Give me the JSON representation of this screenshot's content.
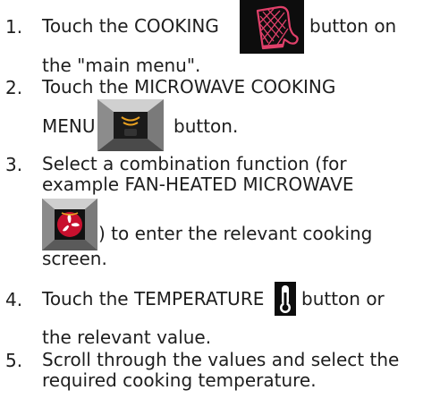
{
  "steps": [
    {
      "num": "1.",
      "line1_before": "Touch the COOKING",
      "line1_after": "button on",
      "line2": "the \"main menu\".",
      "icon": "oven-mitt-icon"
    },
    {
      "num": "2.",
      "line1": "Touch the MICROWAVE COOKING",
      "line2_before": "MENU",
      "line2_after": "button.",
      "icon": "microwave-menu-icon"
    },
    {
      "num": "3.",
      "line1": "Select a combination function (for",
      "line2": "example FAN-HEATED MICROWAVE",
      "line3_after": ") to enter the relevant cooking",
      "line4": "screen.",
      "icon": "fan-heated-microwave-icon"
    },
    {
      "num": "4.",
      "line1_before": "Touch the TEMPERATURE",
      "line1_after": "button or",
      "line2": "the relevant value.",
      "icon": "thermometer-icon"
    },
    {
      "num": "5.",
      "line1": "Scroll through the values and select the",
      "line2": "required cooking temperature."
    }
  ],
  "colors": {
    "text": "#1e1e1e",
    "icon_bg": "#0d0d0d",
    "mitt_accent": "#e0406a",
    "fan_red": "#c8102e",
    "waves": "#e8a020"
  }
}
